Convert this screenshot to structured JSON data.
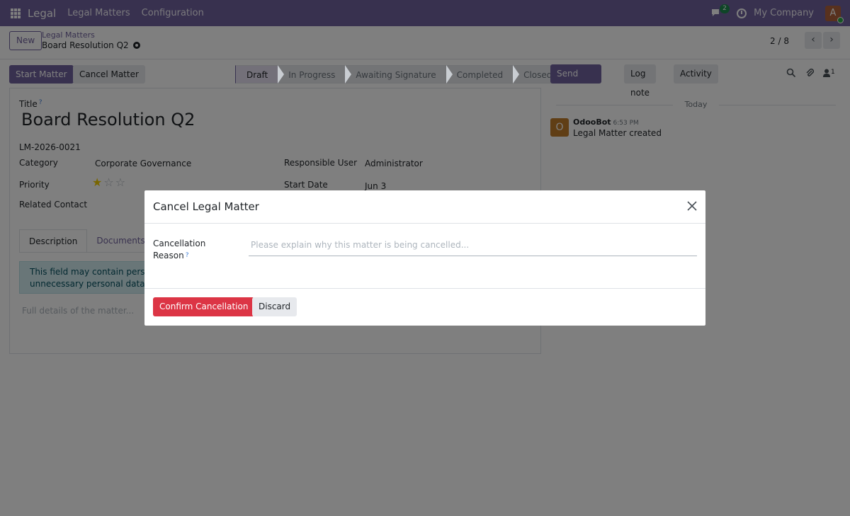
{
  "navbar": {
    "brand": "Legal",
    "menu": [
      "Legal Matters",
      "Configuration"
    ],
    "chat_count": "2",
    "company": "My Company",
    "avatar_letter": "A"
  },
  "control": {
    "new_label": "New",
    "breadcrumb_parent": "Legal Matters",
    "breadcrumb_current": "Board Resolution Q2",
    "pager": "2 / 8"
  },
  "statusbar": {
    "start_label": "Start Matter",
    "cancel_label": "Cancel Matter",
    "stages": [
      "Draft",
      "In Progress",
      "Awaiting Signature",
      "Completed",
      "Closed"
    ],
    "active_stage": "Draft"
  },
  "form": {
    "title_label": "Title",
    "title_value": "Board Resolution Q2",
    "reference": "LM-2026-0021",
    "category_label": "Category",
    "category_value": "Corporate Governance",
    "priority_label": "Priority",
    "priority_stars": 1,
    "priority_max": 3,
    "related_contact_label": "Related Contact",
    "responsible_label": "Responsible User",
    "responsible_value": "Administrator",
    "start_date_label": "Start Date",
    "start_date_value": "Jun 3",
    "tabs": [
      "Description",
      "Documents"
    ],
    "alert_line1": "This field may contain perso",
    "alert_line2": "unnecessary personal data h",
    "description_placeholder": "Full details of the matter..."
  },
  "chatter": {
    "send_message": "Send message",
    "log_note": "Log note",
    "activity": "Activity",
    "follower_count": "1",
    "today": "Today",
    "author": "OdooBot",
    "avatar_letter": "O",
    "time": "6:53 PM",
    "message": "Legal Matter created"
  },
  "modal": {
    "title": "Cancel Legal Matter",
    "field_label": "Cancellation Reason",
    "field_help": "?",
    "field_placeholder": "Please explain why this matter is being cancelled...",
    "confirm_label": "Confirm Cancellation",
    "discard_label": "Discard"
  },
  "colors": {
    "brand": "#71639e",
    "danger": "#dc3545",
    "star": "#f3cc00"
  }
}
